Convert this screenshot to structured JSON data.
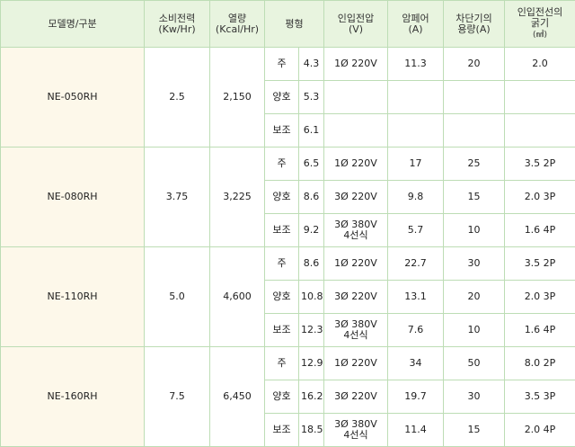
{
  "headers": {
    "model": "모델명/구분",
    "power": [
      "소비전력",
      "(Kw/Hr)"
    ],
    "heat": [
      "열량",
      "(Kcal/Hr)"
    ],
    "area": "평형",
    "voltage": [
      "인입전압",
      "(V)"
    ],
    "ampere": [
      "암페어",
      "(A)"
    ],
    "breaker": [
      "차단기의",
      "용량(A)"
    ],
    "wire": [
      "인입전선의",
      "굵기",
      "(㎟)"
    ]
  },
  "models": [
    {
      "name": "NE-050RH",
      "power": "2.5",
      "heat": "2,150",
      "rows": [
        {
          "type": "주",
          "size": "4.3",
          "voltage": "1Ø  220V",
          "ampere": "11.3",
          "breaker": "20",
          "wire": "2.0"
        },
        {
          "type": "양호",
          "size": "5.3",
          "voltage": "",
          "ampere": "",
          "breaker": "",
          "wire": ""
        },
        {
          "type": "보조",
          "size": "6.1",
          "voltage": "",
          "ampere": "",
          "breaker": "",
          "wire": ""
        }
      ]
    },
    {
      "name": "NE-080RH",
      "power": "3.75",
      "heat": "3,225",
      "rows": [
        {
          "type": "주",
          "size": "6.5",
          "voltage": "1Ø  220V",
          "ampere": "17",
          "breaker": "25",
          "wire": "3.5 2P"
        },
        {
          "type": "양호",
          "size": "8.6",
          "voltage": "3Ø  220V",
          "ampere": "9.8",
          "breaker": "15",
          "wire": "2.0 3P"
        },
        {
          "type": "보조",
          "size": "9.2",
          "voltage": "3Ø  380V\n4선식",
          "ampere": "5.7",
          "breaker": "10",
          "wire": "1.6 4P"
        }
      ]
    },
    {
      "name": "NE-110RH",
      "power": "5.0",
      "heat": "4,600",
      "rows": [
        {
          "type": "주",
          "size": "8.6",
          "voltage": "1Ø  220V",
          "ampere": "22.7",
          "breaker": "30",
          "wire": "3.5 2P"
        },
        {
          "type": "양호",
          "size": "10.8",
          "voltage": "3Ø  220V",
          "ampere": "13.1",
          "breaker": "20",
          "wire": "2.0 3P"
        },
        {
          "type": "보조",
          "size": "12.3",
          "voltage": "3Ø  380V\n4선식",
          "ampere": "7.6",
          "breaker": "10",
          "wire": "1.6 4P"
        }
      ]
    },
    {
      "name": "NE-160RH",
      "power": "7.5",
      "heat": "6,450",
      "rows": [
        {
          "type": "주",
          "size": "12.9",
          "voltage": "1Ø  220V",
          "ampere": "34",
          "breaker": "50",
          "wire": "8.0 2P"
        },
        {
          "type": "양호",
          "size": "16.2",
          "voltage": "3Ø  220V",
          "ampere": "19.7",
          "breaker": "30",
          "wire": "3.5 3P"
        },
        {
          "type": "보조",
          "size": "18.5",
          "voltage": "3Ø  380V\n4선식",
          "ampere": "11.4",
          "breaker": "15",
          "wire": "2.0 4P"
        }
      ]
    }
  ]
}
